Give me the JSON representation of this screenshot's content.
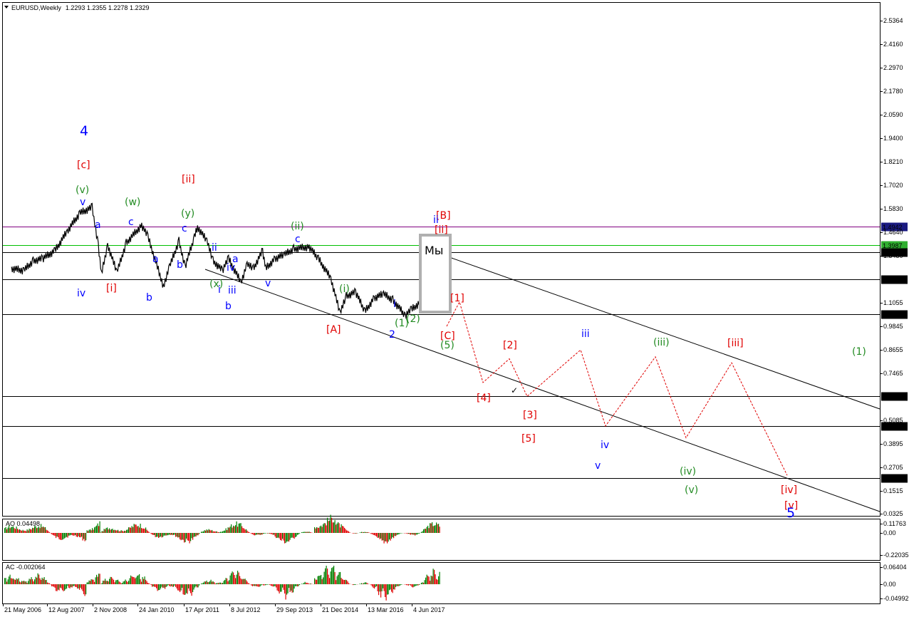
{
  "header": {
    "symbol": "EURUSD,Weekly",
    "ohlc": "1.2293 1.2355 1.2278 1.2329"
  },
  "colors": {
    "price": "#000000",
    "wave_blue": "#0000ff",
    "wave_green": "#228b22",
    "wave_red": "#e00000",
    "level_purple": "#800080",
    "level_green": "#00c000",
    "level_gray_badge": "#d8d8d8",
    "ao_up": "#008000",
    "ao_down": "#e00000"
  },
  "chart_data": [
    {
      "type": "line",
      "name": "main",
      "symbol": "EURUSD",
      "timeframe": "Weekly",
      "y_scale": "log",
      "ylim": [
        0.0325,
        2.5364
      ],
      "y_ticks": [
        "2.5364",
        "2.4160",
        "2.2970",
        "2.1780",
        "2.0590",
        "1.9400",
        "1.8210",
        "1.7020",
        "1.5830",
        "1.4640",
        "1.3450",
        "1.1055",
        "0.9845",
        "0.8655",
        "0.7465",
        "0.5085",
        "0.3895",
        "0.2705",
        "0.1515",
        "0.0325"
      ],
      "x_ticks": [
        "21 May 2006",
        "12 Aug 2007",
        "2 Nov 2008",
        "24 Jan 2010",
        "17 Apr 2011",
        "8 Jul 2012",
        "29 Sep 2013",
        "21 Dec 2014",
        "13 Mar 2016",
        "4 Jun 2017"
      ],
      "horizontal_levels": [
        {
          "value": "1.4942",
          "color": "#800080",
          "badge": "#1a1a80"
        },
        {
          "value": "1.3987",
          "color": "#00c000",
          "badge": "#2faf2f"
        },
        {
          "value": "1.3617",
          "color": "#000000",
          "badge": "#000000"
        },
        {
          "value": "1.2246",
          "color": "#000000",
          "badge": "#000000"
        },
        {
          "value": "1.0457",
          "color": "#000000",
          "badge": "#000000"
        },
        {
          "value": "0.6297",
          "color": "#000000",
          "badge": "#000000"
        },
        {
          "value": "0.4788",
          "color": "#000000",
          "badge": "#000000"
        },
        {
          "value": "0.2150",
          "color": "#000000",
          "badge": "#000000"
        }
      ],
      "price_series": [
        [
          "May 2006",
          1.28
        ],
        [
          "Sep 2006",
          1.27
        ],
        [
          "Dec 2006",
          1.32
        ],
        [
          "Mar 2007",
          1.33
        ],
        [
          "Jul 2007",
          1.37
        ],
        [
          "Nov 2007",
          1.47
        ],
        [
          "Mar 2008",
          1.56
        ],
        [
          "Jul 2008",
          1.59
        ],
        [
          "Sep 2008",
          1.4
        ],
        [
          "Oct 2008",
          1.25
        ],
        [
          "Dec 2008",
          1.4
        ],
        [
          "Mar 2009",
          1.26
        ],
        [
          "Jun 2009",
          1.41
        ],
        [
          "Nov 2009",
          1.5
        ],
        [
          "Jan 2010",
          1.44
        ],
        [
          "Jun 2010",
          1.19
        ],
        [
          "Aug 2010",
          1.29
        ],
        [
          "Nov 2010",
          1.42
        ],
        [
          "Jan 2011",
          1.29
        ],
        [
          "Apr 2011",
          1.44
        ],
        [
          "May 2011",
          1.49
        ],
        [
          "Aug 2011",
          1.42
        ],
        [
          "Oct 2011",
          1.32
        ],
        [
          "Jan 2012",
          1.27
        ],
        [
          "Mar 2012",
          1.33
        ],
        [
          "Jul 2012",
          1.21
        ],
        [
          "Sep 2012",
          1.3
        ],
        [
          "Nov 2012",
          1.28
        ],
        [
          "Feb 2013",
          1.37
        ],
        [
          "Mar 2013",
          1.28
        ],
        [
          "Jun 2013",
          1.33
        ],
        [
          "Sep 2013",
          1.35
        ],
        [
          "Dec 2013",
          1.38
        ],
        [
          "May 2014",
          1.39
        ],
        [
          "Aug 2014",
          1.33
        ],
        [
          "Dec 2014",
          1.23
        ],
        [
          "Mar 2015",
          1.05
        ],
        [
          "May 2015",
          1.14
        ],
        [
          "Aug 2015",
          1.16
        ],
        [
          "Nov 2015",
          1.06
        ],
        [
          "Feb 2016",
          1.13
        ],
        [
          "May 2016",
          1.15
        ],
        [
          "Aug 2016",
          1.12
        ],
        [
          "Dec 2016",
          1.04
        ],
        [
          "Feb 2017",
          1.07
        ],
        [
          "May 2017",
          1.11
        ],
        [
          "Aug 2017",
          1.19
        ],
        [
          "Nov 2017",
          1.18
        ],
        [
          "Jan 2018",
          1.23
        ]
      ],
      "forecast_paths": [
        {
          "color": "#e00000",
          "style": "dashed",
          "points": [
            [
              "[1]",
              0.9845
            ],
            [
              "[2]",
              1.11
            ],
            [
              "[3]",
              0.7
            ],
            [
              "[4]",
              0.82
            ],
            [
              "[5]",
              0.63
            ],
            [
              "iv",
              0.865
            ],
            [
              "v",
              0.48
            ],
            [
              "(iv)",
              0.83
            ],
            [
              "(v)",
              0.42
            ],
            [
              "[iv]",
              0.8
            ],
            [
              "[v]",
              0.23
            ]
          ]
        }
      ],
      "wave_labels": [
        {
          "text": "4",
          "color": "#0000ff",
          "size": "large"
        },
        {
          "text": "[c]",
          "color": "#e00000"
        },
        {
          "text": "(v)",
          "color": "#228b22"
        },
        {
          "text": "v",
          "color": "#0000ff"
        },
        {
          "text": "(w)",
          "color": "#228b22"
        },
        {
          "text": "[ii]",
          "color": "#e00000"
        },
        {
          "text": "(y)",
          "color": "#228b22"
        },
        {
          "text": "a",
          "color": "#0000ff"
        },
        {
          "text": "c",
          "color": "#0000ff"
        },
        {
          "text": "a",
          "color": "#0000ff"
        },
        {
          "text": "b",
          "color": "#0000ff"
        },
        {
          "text": "c",
          "color": "#0000ff"
        },
        {
          "text": "ii",
          "color": "#0000ff"
        },
        {
          "text": "(ii)",
          "color": "#228b22"
        },
        {
          "text": "c",
          "color": "#0000ff"
        },
        {
          "text": "a",
          "color": "#0000ff"
        },
        {
          "text": "iv",
          "color": "#0000ff"
        },
        {
          "text": "iv",
          "color": "#0000ff"
        },
        {
          "text": "[i]",
          "color": "#e00000"
        },
        {
          "text": "b",
          "color": "#0000ff"
        },
        {
          "text": "(x)",
          "color": "#228b22"
        },
        {
          "text": "i",
          "color": "#0000ff"
        },
        {
          "text": "iii",
          "color": "#0000ff"
        },
        {
          "text": "v",
          "color": "#0000ff"
        },
        {
          "text": "b",
          "color": "#0000ff"
        },
        {
          "text": "(i)",
          "color": "#228b22"
        },
        {
          "text": "[A]",
          "color": "#e00000"
        },
        {
          "text": "i",
          "color": "#0000ff"
        },
        {
          "text": "(1)",
          "color": "#228b22"
        },
        {
          "text": "(2)",
          "color": "#228b22"
        },
        {
          "text": "2",
          "color": "#0000ff"
        },
        {
          "text": "[B]",
          "color": "#e00000"
        },
        {
          "text": "ii",
          "color": "#0000ff"
        },
        {
          "text": "[ii]",
          "color": "#e00000"
        },
        {
          "text": "[C]",
          "color": "#e00000"
        },
        {
          "text": "(5)",
          "color": "#228b22"
        },
        {
          "text": "[1]",
          "color": "#e00000"
        },
        {
          "text": "[2]",
          "color": "#e00000"
        },
        {
          "text": "[4]",
          "color": "#e00000"
        },
        {
          "text": "[3]",
          "color": "#e00000"
        },
        {
          "text": "[5]",
          "color": "#e00000"
        },
        {
          "text": "iii",
          "color": "#0000ff"
        },
        {
          "text": "iv",
          "color": "#0000ff"
        },
        {
          "text": "v",
          "color": "#0000ff"
        },
        {
          "text": "(iii)",
          "color": "#228b22"
        },
        {
          "text": "(iv)",
          "color": "#228b22"
        },
        {
          "text": "(v)",
          "color": "#228b22"
        },
        {
          "text": "[iii]",
          "color": "#e00000"
        },
        {
          "text": "[iv]",
          "color": "#e00000"
        },
        {
          "text": "[v]",
          "color": "#e00000"
        },
        {
          "text": "5",
          "color": "#0000ff",
          "size": "large"
        },
        {
          "text": "(1)",
          "color": "#228b22"
        },
        {
          "text": "(2)",
          "color": "#228b22",
          "size": "large"
        }
      ],
      "annotations": [
        {
          "text": "Мы",
          "kind": "marker-box",
          "color": "#000000"
        },
        {
          "text": "✓",
          "kind": "checkmark",
          "color": "#000000"
        }
      ]
    },
    {
      "type": "bar",
      "name": "AO",
      "label": "AO 0.04498",
      "ylim": [
        -0.22035,
        0.11763
      ],
      "y_ticks": [
        "0.11763",
        "0.00",
        "-0.22035"
      ],
      "colors": {
        "up": "#008000",
        "down": "#e00000"
      }
    },
    {
      "type": "bar",
      "name": "AC",
      "label": "AC -0.002064",
      "ylim": [
        -0.04992,
        0.06404
      ],
      "y_ticks": [
        "0.06404",
        "0.00",
        "-0.04992"
      ],
      "colors": {
        "up": "#008000",
        "down": "#e00000"
      }
    }
  ]
}
